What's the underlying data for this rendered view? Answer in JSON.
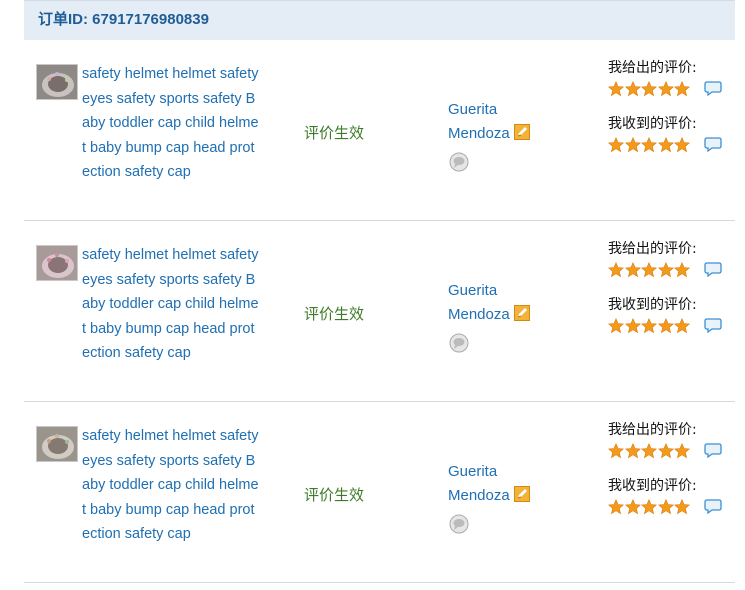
{
  "order": {
    "id_label": "订单ID: 67917176980839"
  },
  "colors": {
    "link": "#1f6fb2",
    "status": "#3f7a2a",
    "star": "#f39a1c",
    "header_bg": "#e4ecf5"
  },
  "items": [
    {
      "title": "safety helmet helmet safety eyes safety sports safety Baby toddler cap child helmet baby bump cap head protection safety cap",
      "status": "评价生效",
      "seller_first": "Guerita",
      "seller_last": "Mendoza",
      "given_label": "我给出的评价:",
      "given_stars": 5,
      "received_label": "我收到的评价:",
      "received_stars": 5
    },
    {
      "title": "safety helmet helmet safety eyes safety sports safety Baby toddler cap child helmet baby bump cap head protection safety cap",
      "status": "评价生效",
      "seller_first": "Guerita",
      "seller_last": "Mendoza",
      "given_label": "我给出的评价:",
      "given_stars": 5,
      "received_label": "我收到的评价:",
      "received_stars": 5
    },
    {
      "title": "safety helmet helmet safety eyes safety sports safety Baby toddler cap child helmet baby bump cap head protection safety cap",
      "status": "评价生效",
      "seller_first": "Guerita",
      "seller_last": "Mendoza",
      "given_label": "我给出的评价:",
      "given_stars": 5,
      "received_label": "我收到的评价:",
      "received_stars": 5
    }
  ]
}
